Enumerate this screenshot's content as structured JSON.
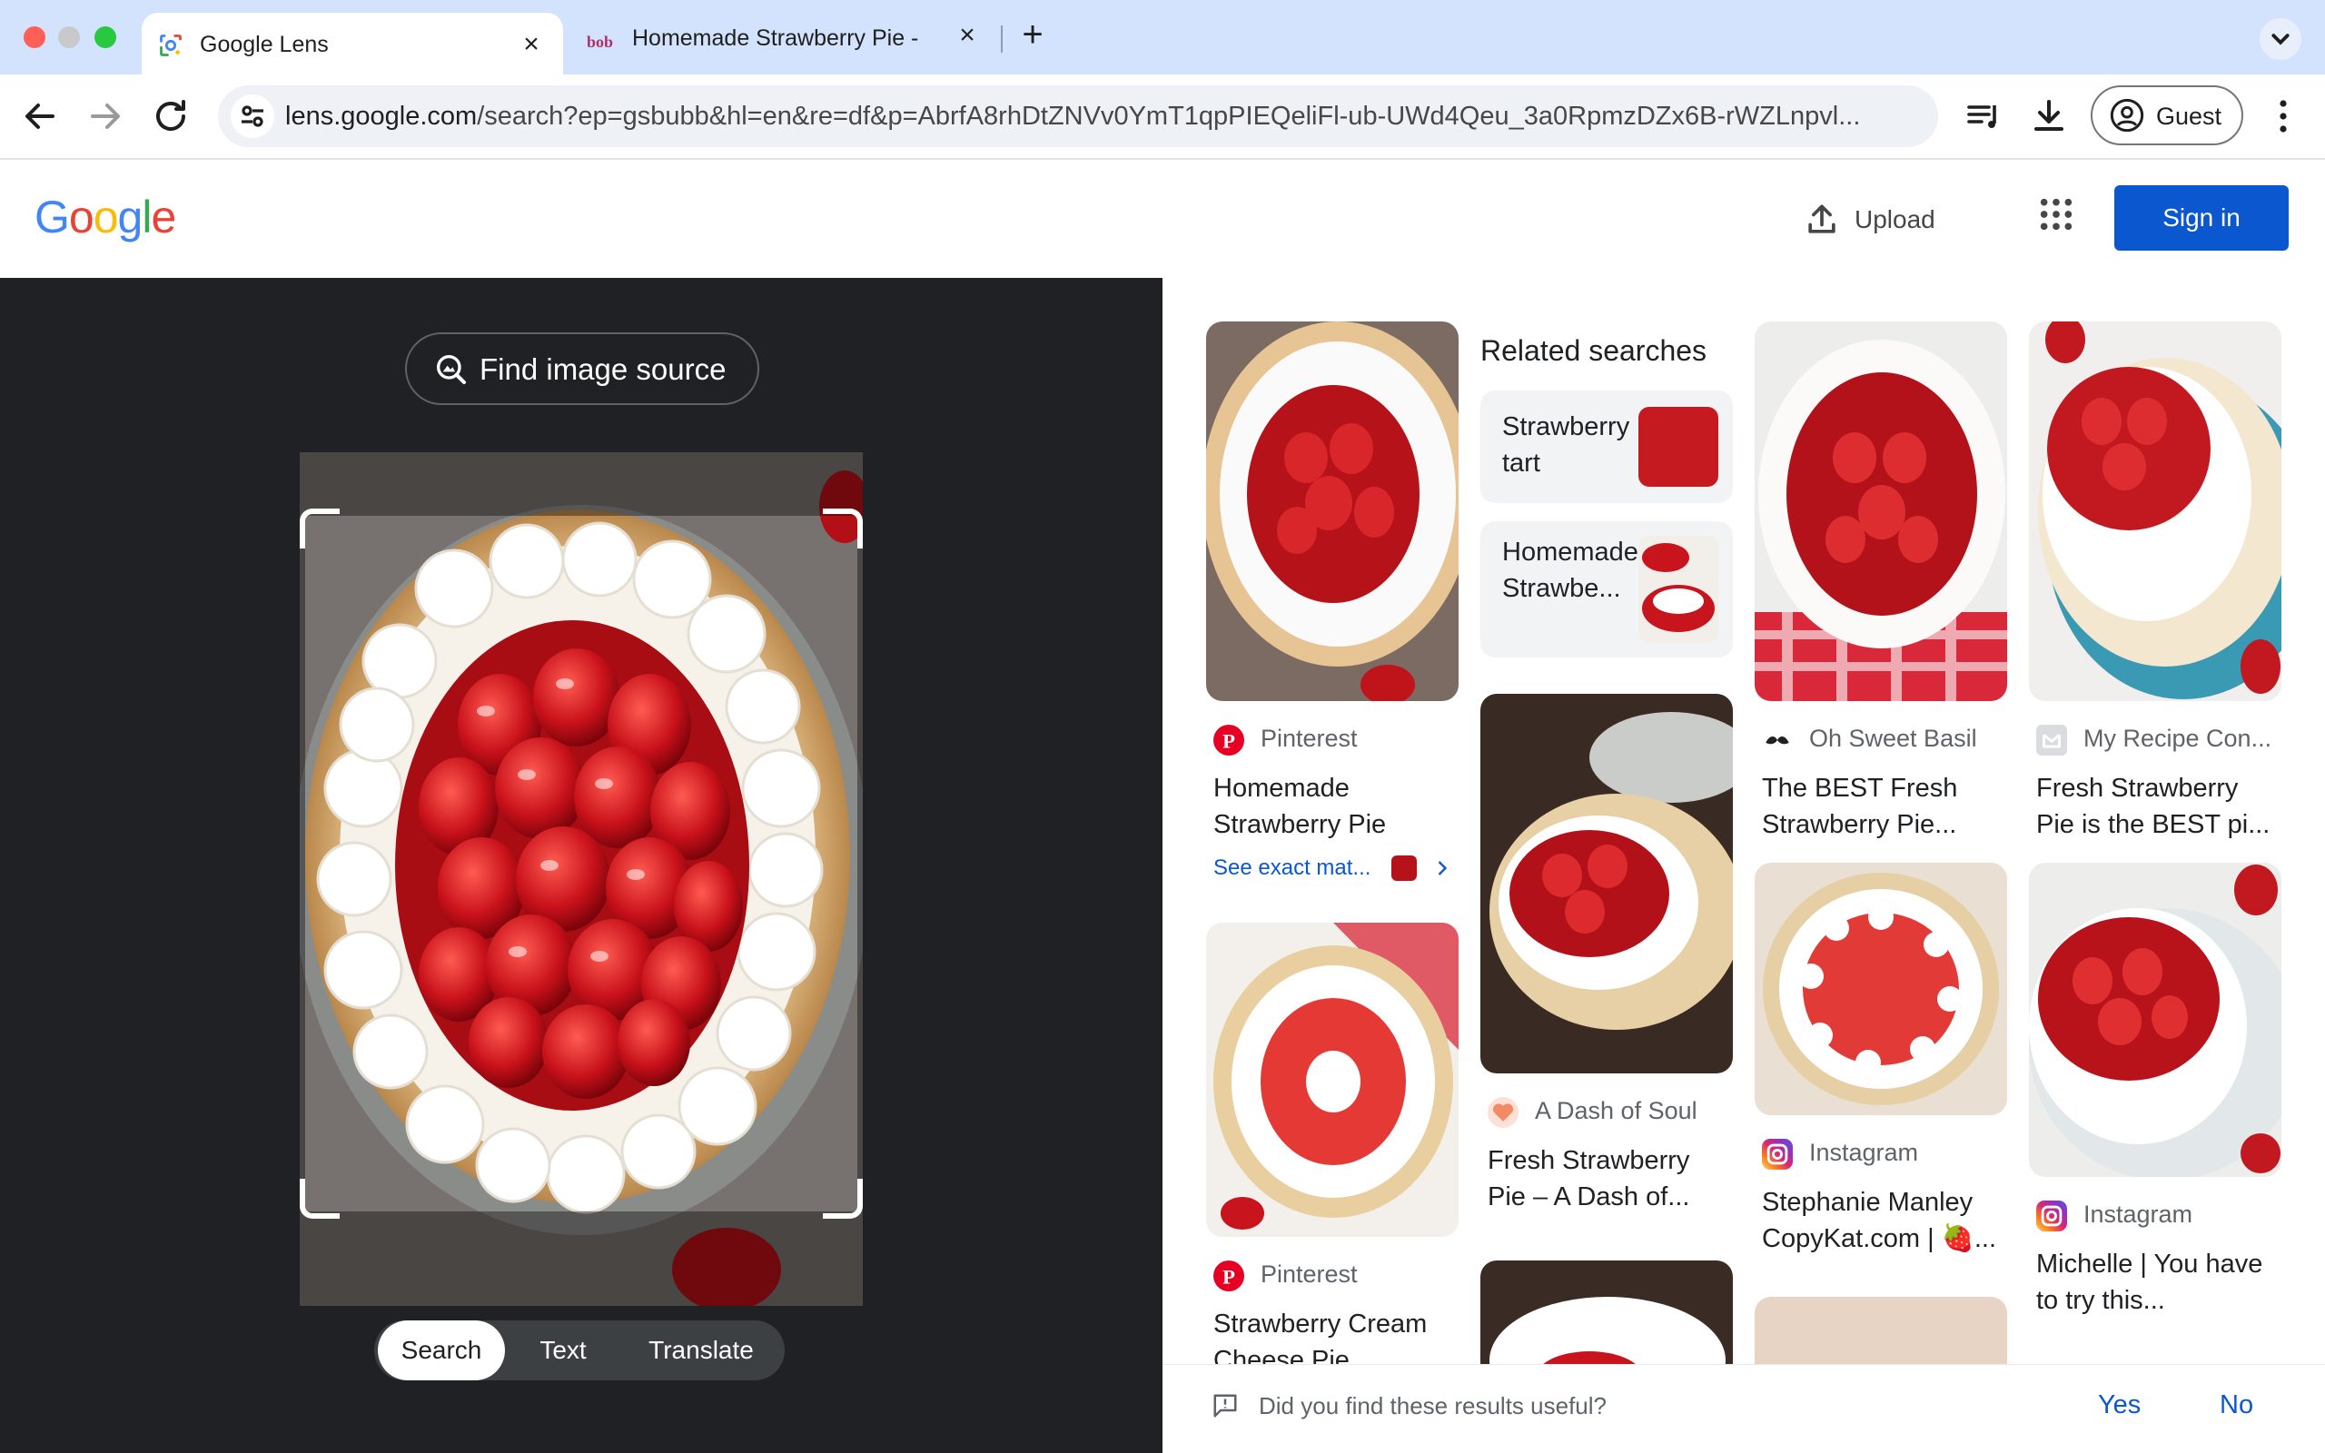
{
  "browser": {
    "tabs": [
      {
        "title": "Google Lens",
        "active": true
      },
      {
        "title": "Homemade Strawberry Pie - ",
        "active": false
      }
    ],
    "new_tab_label": "+",
    "close_label": "×",
    "url_host": "lens.google.com",
    "url_rest": "/search?ep=gsbubb&hl=en&re=df&p=AbrfA8rhDtZNVv0YmT1qpPIEQeliFl-ub-UWd4Qeu_3a0RpmzDZx6B-rWZLnpvl...",
    "profile_label": "Guest"
  },
  "header": {
    "logo": "Google",
    "upload_label": "Upload",
    "signin_label": "Sign in",
    "colors": {
      "blue": "#4285F4",
      "red": "#EA4335",
      "yellow": "#FBBC05",
      "green": "#34A853"
    }
  },
  "lens": {
    "find_source_label": "Find image source",
    "modes": [
      "Search",
      "Text",
      "Translate"
    ],
    "active_mode": "Search"
  },
  "results": {
    "related_searches_title": "Related searches",
    "related": [
      {
        "label": "Strawberry tart"
      },
      {
        "label": "Homemade Strawbe..."
      }
    ],
    "cards": [
      {
        "source": "Pinterest",
        "title": "Homemade Strawberry Pie",
        "exact_label": "See exact mat..."
      },
      {
        "source": "Pinterest",
        "title": "Strawberry Cream Cheese Pie"
      },
      {
        "source": "A Dash of Soul",
        "title": "Fresh Strawberry Pie – A Dash of..."
      },
      {
        "source": "Oh Sweet Basil",
        "title": "The BEST Fresh Strawberry Pie..."
      },
      {
        "source": "Instagram",
        "title": "Stephanie Manley CopyKat.com | 🍓..."
      },
      {
        "source": "My Recipe Con...",
        "title": "Fresh Strawberry Pie is the BEST pi..."
      },
      {
        "source": "Instagram",
        "title": "Michelle | You have to try this..."
      }
    ],
    "feedback": {
      "question": "Did you find these results useful?",
      "yes": "Yes",
      "no": "No"
    }
  }
}
